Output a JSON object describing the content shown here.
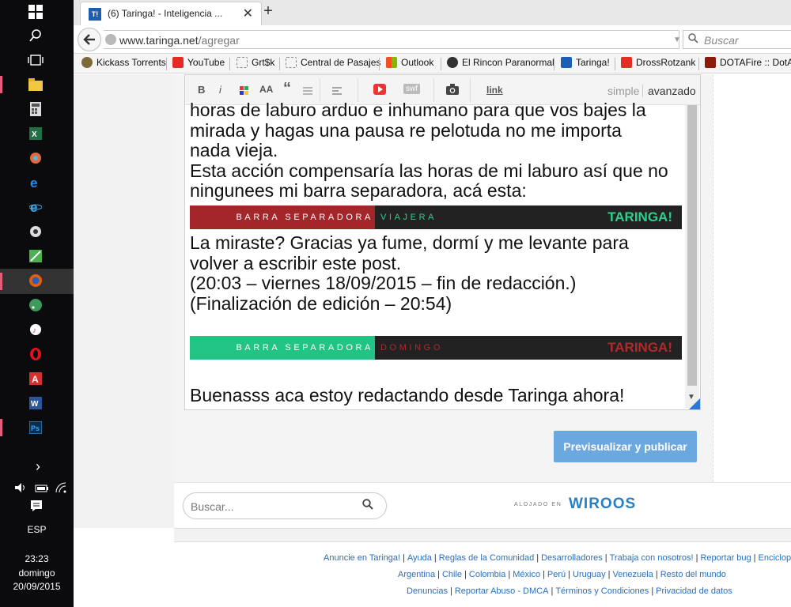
{
  "taskbar": {
    "icons": [
      "windows-start-icon",
      "search-icon",
      "task-view-icon",
      "file-explorer-icon",
      "calculator-icon",
      "excel-icon",
      "app-icon",
      "edge-icon",
      "ie-icon",
      "steam-icon",
      "app-green-icon",
      "firefox-icon",
      "rss-icon",
      "itunes-icon",
      "opera-icon",
      "acrobat-icon",
      "word-icon",
      "photoshop-icon"
    ],
    "tray": {
      "chevron": "›",
      "lang": "ESP",
      "time": "23:23",
      "day": "domingo",
      "date": "20/09/2015"
    }
  },
  "browser": {
    "tab_title": "(6) Taringa! - Inteligencia ...",
    "tab_favicon": "T!",
    "tab_close": "✕",
    "new_tab": "+",
    "url_host": "www.taringa.net",
    "url_path": "/agregar",
    "search_placeholder": "Buscar",
    "bookmarks": [
      "Kickass Torrents",
      "YouTube",
      "Grt$k",
      "Central de Pasajes",
      "Outlook",
      "El Rincon Paranormal",
      "Taringa!",
      "DrossRotzank",
      "DOTAFire :: DotA"
    ]
  },
  "editor": {
    "toolbar": {
      "bold": "B",
      "italic": "i",
      "font_size": "AA",
      "quote": "“",
      "swf": "swf",
      "link": "link",
      "mode_simple": "simple",
      "mode_advanced": "avanzado"
    },
    "lines": [
      "horas de laburo arduo e inhumano para que vos bajes la",
      "mirada y hagas una pausa re pelotuda no me importa",
      "nada vieja.",
      "Esta acción compensaría las horas de mi laburo así que no",
      "ningunees mi barra separadora, acá esta:"
    ],
    "banner1": {
      "left": "BARRA SEPARADORA",
      "sub": "VIAJERA",
      "logo": "TARINGA!",
      "left_color": "#a3262a",
      "sub_color": "#2ecf8d",
      "logo_color": "#2ecf8d"
    },
    "lines2": [
      "La miraste? Gracias ya fume, dormí y me levante para",
      "volver a escribir este post.",
      "(20:03 – viernes 18/09/2015 – fin de redacción.)",
      "(Finalización de edición – 20:54)"
    ],
    "banner2": {
      "left": "BARRA SEPARADORA",
      "sub": "DOMINGO",
      "logo": "TARINGA!",
      "left_color": "#22c486",
      "sub_color": "#b02a2a",
      "logo_color": "#b02a2a"
    },
    "last_line": "Buenasss aca estoy redactando desde Taringa ahora!"
  },
  "publish_button": "Previsualizar y publicar",
  "bottom": {
    "search_placeholder": "Buscar...",
    "hosted_label": "ALOJADO EN",
    "host_brand": "WIROOS"
  },
  "footer": {
    "row1": [
      "Anuncie en Taringa!",
      "Ayuda",
      "Reglas de la Comunidad",
      "Desarrolladores",
      "Trabaja con nosotros!",
      "Reportar bug",
      "Enciclopedia"
    ],
    "row2": [
      "Argentina",
      "Chile",
      "Colombia",
      "México",
      "Perú",
      "Uruguay",
      "Venezuela",
      "Resto del mundo"
    ],
    "row3": [
      "Denuncias",
      "Reportar Abuso - DMCA",
      "Términos y Condiciones",
      "Privacidad de datos"
    ]
  }
}
